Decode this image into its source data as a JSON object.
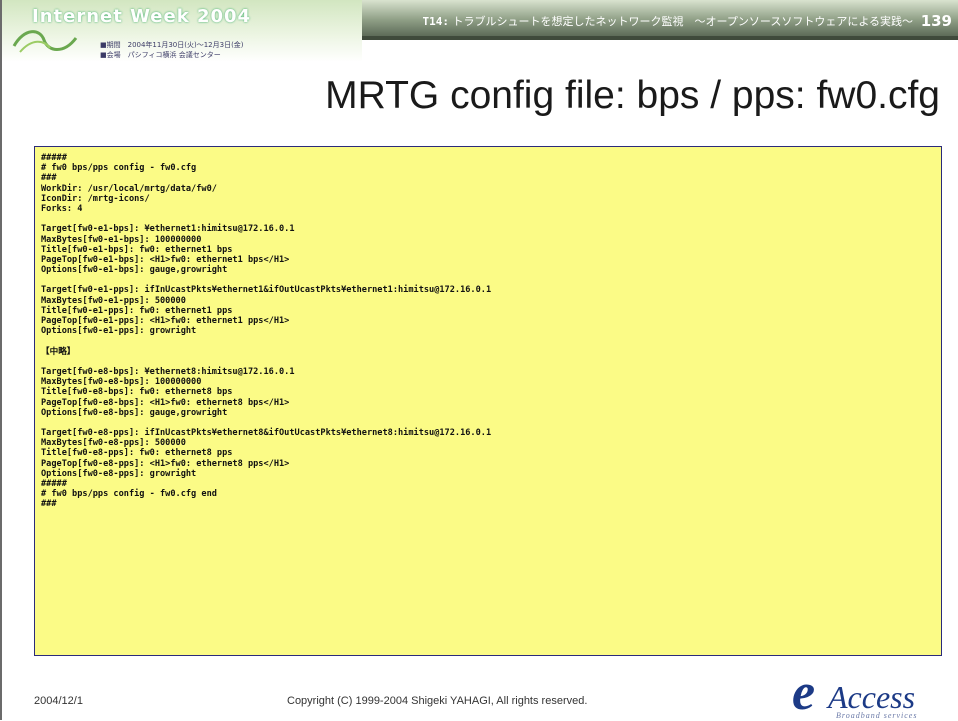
{
  "header": {
    "logo": "Internet Week 2004",
    "event_line1": "■期間　2004年11月30日(火)～12月3日(金)",
    "event_line2": "■会場　パシフィコ横浜 会議センター",
    "session_code": "T14:",
    "session_title": "トラブルシュートを想定したネットワーク監視　～オープンソースソフトウェアによる実践～",
    "page_number": "139"
  },
  "slide": {
    "title": "MRTG config file: bps / pps: fw0.cfg"
  },
  "code": {
    "lines": [
      "#####",
      "# fw0 bps/pps config - fw0.cfg",
      "###",
      "WorkDir: /usr/local/mrtg/data/fw0/",
      "IconDir: /mrtg-icons/",
      "Forks: 4",
      "",
      "Target[fw0-e1-bps]: ¥ethernet1:himitsu@172.16.0.1",
      "MaxBytes[fw0-e1-bps]: 100000000",
      "Title[fw0-e1-bps]: fw0: ethernet1 bps",
      "PageTop[fw0-e1-bps]: <H1>fw0: ethernet1 bps</H1>",
      "Options[fw0-e1-bps]: gauge,growright",
      "",
      "Target[fw0-e1-pps]: ifInUcastPkts¥ethernet1&ifOutUcastPkts¥ethernet1:himitsu@172.16.0.1",
      "MaxBytes[fw0-e1-pps]: 500000",
      "Title[fw0-e1-pps]: fw0: ethernet1 pps",
      "PageTop[fw0-e1-pps]: <H1>fw0: ethernet1 pps</H1>",
      "Options[fw0-e1-pps]: growright",
      "",
      "【中略】",
      "",
      "Target[fw0-e8-bps]: ¥ethernet8:himitsu@172.16.0.1",
      "MaxBytes[fw0-e8-bps]: 100000000",
      "Title[fw0-e8-bps]: fw0: ethernet8 bps",
      "PageTop[fw0-e8-bps]: <H1>fw0: ethernet8 bps</H1>",
      "Options[fw0-e8-bps]: gauge,growright",
      "",
      "Target[fw0-e8-pps]: ifInUcastPkts¥ethernet8&ifOutUcastPkts¥ethernet8:himitsu@172.16.0.1",
      "MaxBytes[fw0-e8-pps]: 500000",
      "Title[fw0-e8-pps]: fw0: ethernet8 pps",
      "PageTop[fw0-e8-pps]: <H1>fw0: ethernet8 pps</H1>",
      "Options[fw0-e8-pps]: growright",
      "#####",
      "# fw0 bps/pps config - fw0.cfg end",
      "###"
    ]
  },
  "footer": {
    "date": "2004/12/1",
    "copyright": "Copyright (C) 1999-2004 Shigeki YAHAGI, All rights reserved.",
    "brand_letter": "e",
    "brand_word": "Access",
    "brand_tagline": "Broadband services"
  }
}
